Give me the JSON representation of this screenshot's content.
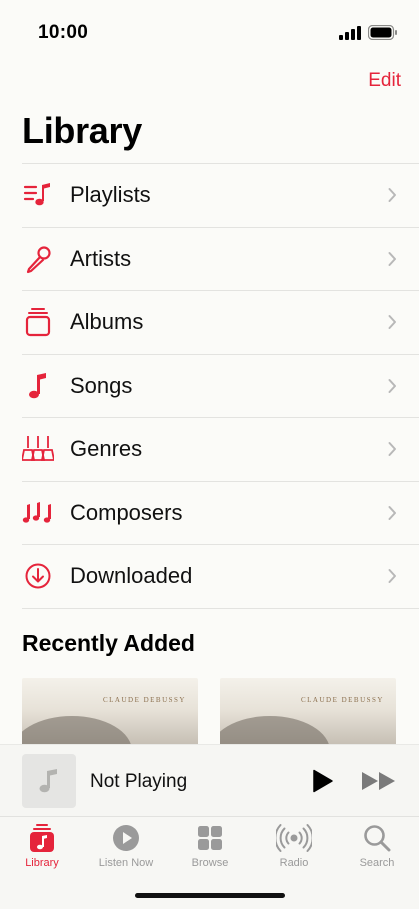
{
  "status_bar": {
    "time": "10:00"
  },
  "header": {
    "edit_label": "Edit",
    "title": "Library"
  },
  "library_items": [
    {
      "label": "Playlists",
      "icon": "playlists-icon"
    },
    {
      "label": "Artists",
      "icon": "microphone-icon"
    },
    {
      "label": "Albums",
      "icon": "albums-icon"
    },
    {
      "label": "Songs",
      "icon": "music-note-icon"
    },
    {
      "label": "Genres",
      "icon": "genres-icon"
    },
    {
      "label": "Composers",
      "icon": "composers-icon"
    },
    {
      "label": "Downloaded",
      "icon": "download-icon"
    }
  ],
  "recently_added": {
    "title": "Recently Added",
    "albums": [
      {
        "artwork_text": "CLAUDE DEBUSSY"
      },
      {
        "artwork_text": "CLAUDE DEBUSSY"
      }
    ]
  },
  "mini_player": {
    "title": "Not Playing"
  },
  "tabs": [
    {
      "label": "Library",
      "icon": "library-icon",
      "active": true
    },
    {
      "label": "Listen Now",
      "icon": "play-circle-icon",
      "active": false
    },
    {
      "label": "Browse",
      "icon": "grid-icon",
      "active": false
    },
    {
      "label": "Radio",
      "icon": "radio-icon",
      "active": false
    },
    {
      "label": "Search",
      "icon": "search-icon",
      "active": false
    }
  ],
  "colors": {
    "accent": "#e5243b",
    "inactive": "#9a9a9a",
    "background": "#fbfbf8"
  }
}
